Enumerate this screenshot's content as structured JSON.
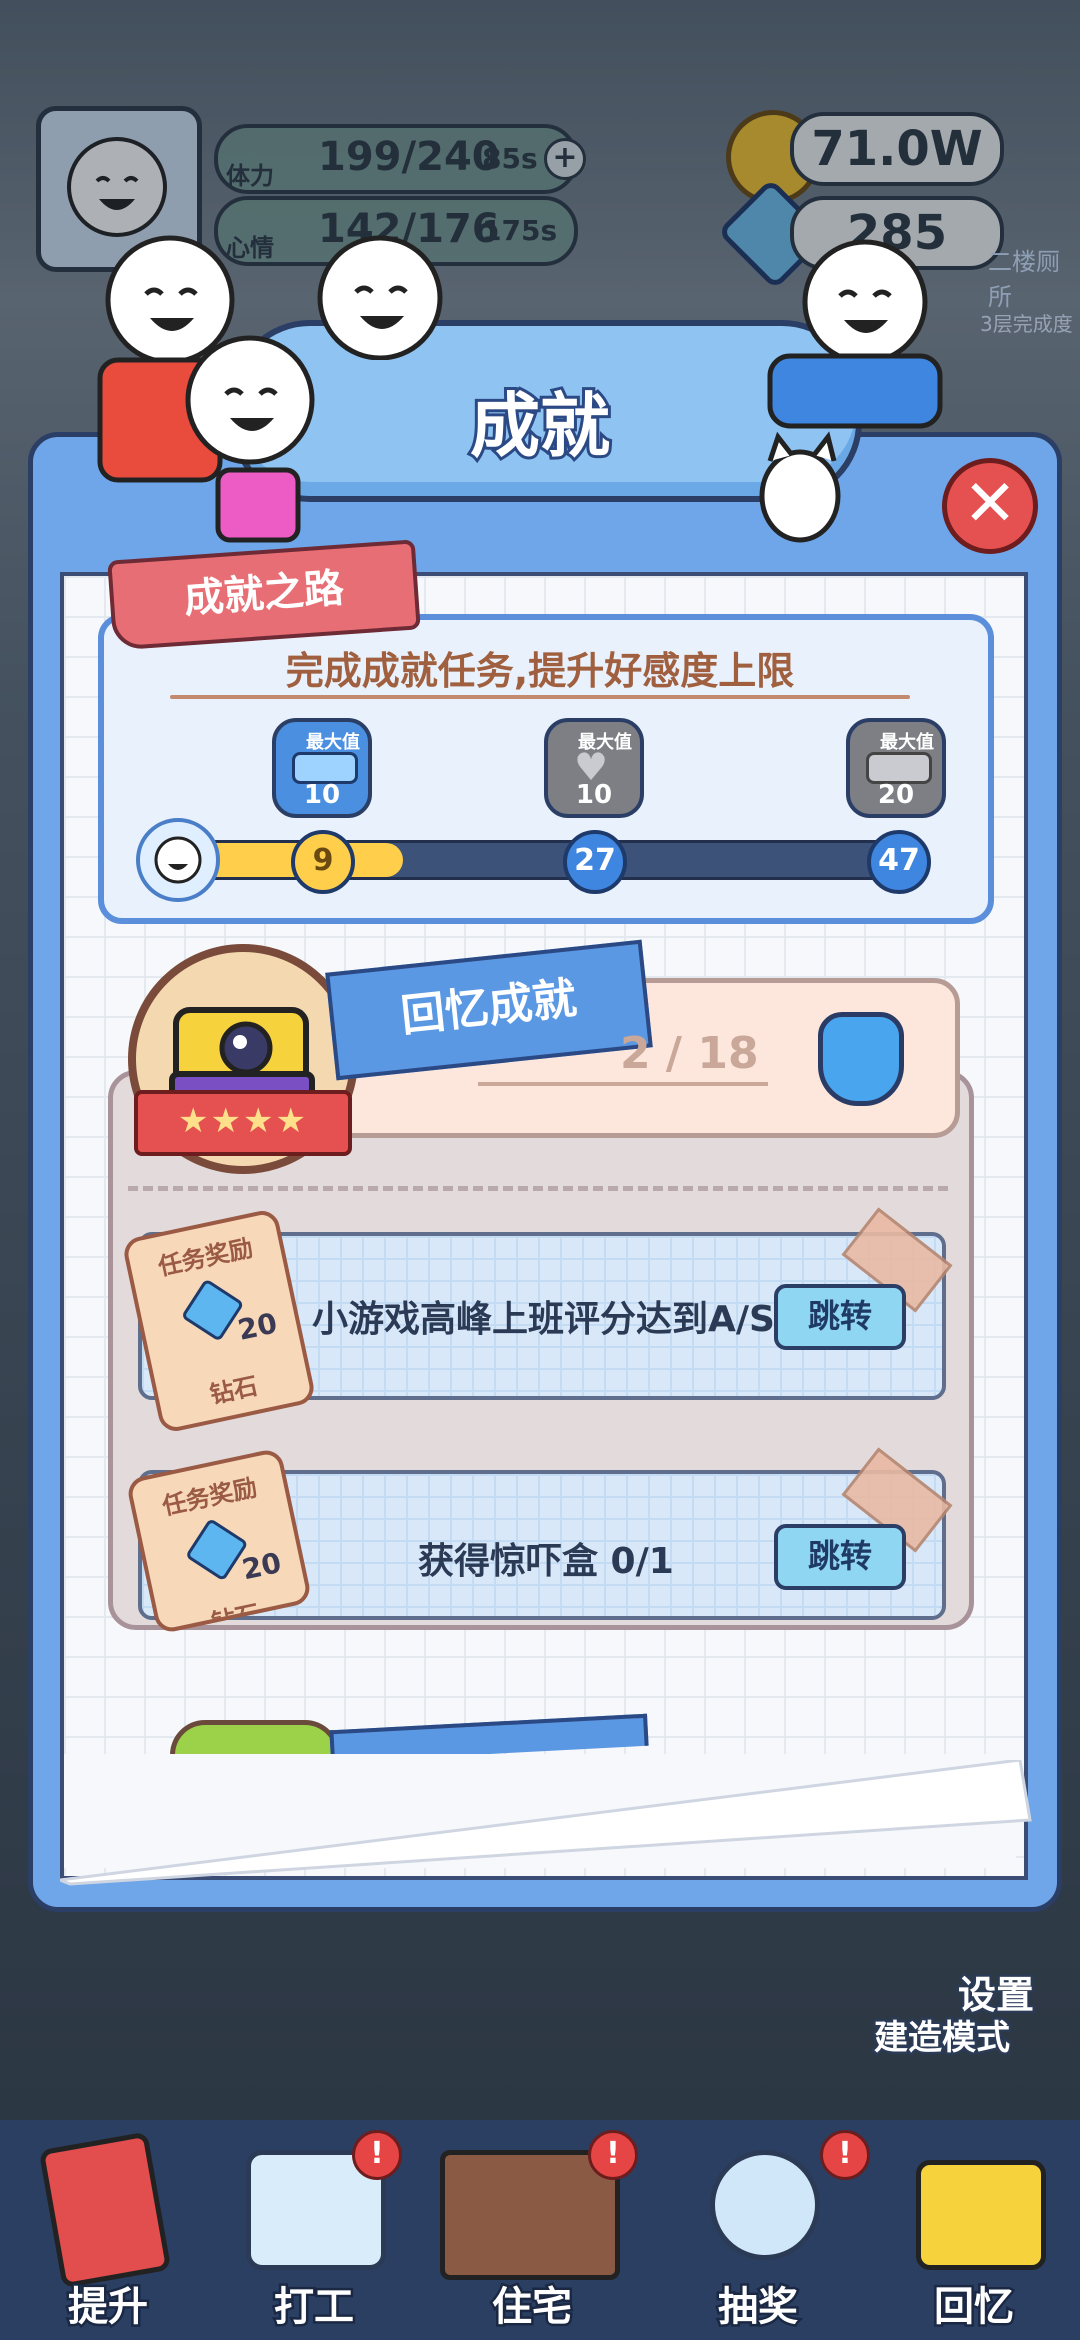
{
  "hud": {
    "stamina_label": "体力",
    "stamina_value": "199/240",
    "stamina_timer": "85s",
    "mood_label": "心情",
    "mood_value": "142/176",
    "mood_timer": "175s",
    "coins": "71.0W",
    "gems": "285",
    "side_note_1": "二楼厕所",
    "side_note_2": "3层完成度"
  },
  "dialog": {
    "title": "成就",
    "road_tag": "成就之路",
    "road_subtitle": "完成成就任务,提升好感度上限",
    "milestones": [
      {
        "cap": "最大值",
        "value": "10",
        "threshold": "9",
        "state": "active",
        "icon": "dumbbell-icon"
      },
      {
        "cap": "最大值",
        "value": "10",
        "threshold": "27",
        "state": "locked",
        "icon": "heart-icon"
      },
      {
        "cap": "最大值",
        "value": "20",
        "threshold": "47",
        "state": "locked",
        "icon": "dumbbell-icon"
      }
    ],
    "progress_fraction": 0.29
  },
  "memory": {
    "title": "回忆成就",
    "progress": "2 / 18",
    "stars": "★★★★"
  },
  "tasks": [
    {
      "tag_title": "任务奖励",
      "reward_amount": "20",
      "reward_label": "钻石",
      "text": "小游戏高峰上班评分达到A/S",
      "button": "跳转"
    },
    {
      "tag_title": "任务奖励",
      "reward_amount": "20",
      "reward_label": "钻石",
      "text": "获得惊吓盒 0/1",
      "button": "跳转"
    }
  ],
  "side": {
    "settings": "设置",
    "build_mode": "建造模式"
  },
  "nav": [
    {
      "label": "提升",
      "alert": false
    },
    {
      "label": "打工",
      "alert": true
    },
    {
      "label": "住宅",
      "alert": true
    },
    {
      "label": "抽奖",
      "alert": true
    },
    {
      "label": "回忆",
      "alert": false
    }
  ],
  "colors": {
    "dialog_blue": "#6fa6ea",
    "progress_yellow": "#ffce4a",
    "close_red": "#e55050"
  }
}
